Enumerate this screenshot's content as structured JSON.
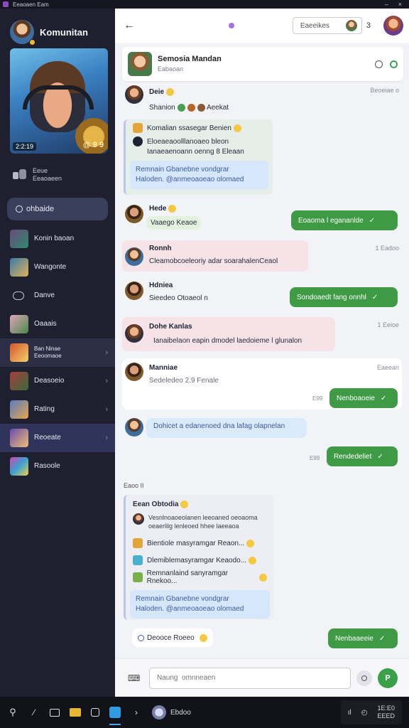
{
  "window": {
    "title": "Eeaoaen Eam",
    "controls": [
      "–",
      "×"
    ]
  },
  "sidebar": {
    "app_name": "Komunitan",
    "hero": {
      "stat_left": "2:2:19",
      "stat_right": "@ 9 9"
    },
    "status": {
      "line1": "Eeue",
      "line2": "Eeaoaeen"
    },
    "search_label": "ohbaide",
    "items": [
      {
        "label": "Konin baoan",
        "thumb": "t1"
      },
      {
        "label": "Wangonte",
        "thumb": "t2"
      },
      {
        "label": "Danve",
        "thumb": "t3"
      },
      {
        "label": "Oaaais",
        "thumb": "t4"
      },
      {
        "label": "Ban Ninae\nEeoomaoe",
        "thumb": "t5",
        "chev": "›"
      },
      {
        "label": "Deasoeio",
        "thumb": "t6",
        "chev": "›"
      },
      {
        "label": "Rating",
        "thumb": "t7",
        "chev": "›"
      },
      {
        "label": "Reoeate",
        "thumb": "t8",
        "chev": "›"
      },
      {
        "label": "Rasoole",
        "thumb": "t9"
      }
    ]
  },
  "topbar": {
    "back": "←",
    "pill_text": "Eaeeikes",
    "count": "3"
  },
  "chat_header": {
    "title": "Semosia Mandan",
    "subtitle": "Eabaoan"
  },
  "messages": {
    "m1": {
      "name": "Deie",
      "text": "Shanion",
      "tail": "Aeekat",
      "time": "Beoeiae o"
    },
    "card1": {
      "lines": [
        "Komalian  ssasegar  Benien",
        "Eloeaeaoolllanoaeo bleon",
        "Ianaeaenoann  oenng  8 Eleaan"
      ],
      "blue_lines": [
        "Remnain  Gbanebne  vondgrar",
        "Haloden.  @anmeoaoeao olomaed"
      ]
    },
    "m2": {
      "name": "Hede",
      "text": "Vaaego Keaoe",
      "out": "Eoaoma l  egananlde"
    },
    "m3": {
      "name": "Ronnh",
      "text": "Cleamobcoeleoriy  adar  soarahalenCeaol",
      "time": "1 Eadoo"
    },
    "m4": {
      "name": "Hdniea",
      "text": "Sieedeo  Otoaeol n",
      "out": "Sondoaedt  fang  onnhl"
    },
    "m5": {
      "name": "Dohe  Kanlas",
      "text": "Ianaibelaon  eapin  dmodel  laedoieme  l glunalon",
      "time": "1 Eeioe"
    },
    "m6": {
      "name": "Manniae",
      "text": "Sedeledeo  2.9  Fenale",
      "time": "Eaeean",
      "out": "Nenboaoeie",
      "stamp": "E99"
    },
    "m7": {
      "text": "Dohicet    a  edanenoed dna lafag olapnelan"
    },
    "m8": {
      "out": "Rendedeliet",
      "stamp": "E99"
    },
    "divider": "Eaoo  II",
    "card2": {
      "name": "Eean Obtodia",
      "quote_lines": [
        "Vesnlnoaoeolanen  leeoaned  oeoaoma",
        "oeaerlilg  lenleoed  hhee laeeaoa"
      ],
      "lines": [
        "Bientiole  masyramgar  Reaon...",
        "Dlemiblemasyramgar  Keaodo...",
        "Remnanlaind  sanyramgar  Rnekoo..."
      ],
      "blue_lines": [
        "Remnain  Gbanebne  vondgrar",
        "Haloden.  @anmeoaoeao olomaed"
      ]
    },
    "m9": {
      "text": "Deooce  Roeeo",
      "out": "Nenbaaeeie"
    }
  },
  "composer": {
    "placeholder": "Naung  omnneaen",
    "send": "P"
  },
  "taskbar": {
    "app_label": "Ebdoo",
    "clock_time": "1E:E0",
    "clock_date": "EEED"
  }
}
